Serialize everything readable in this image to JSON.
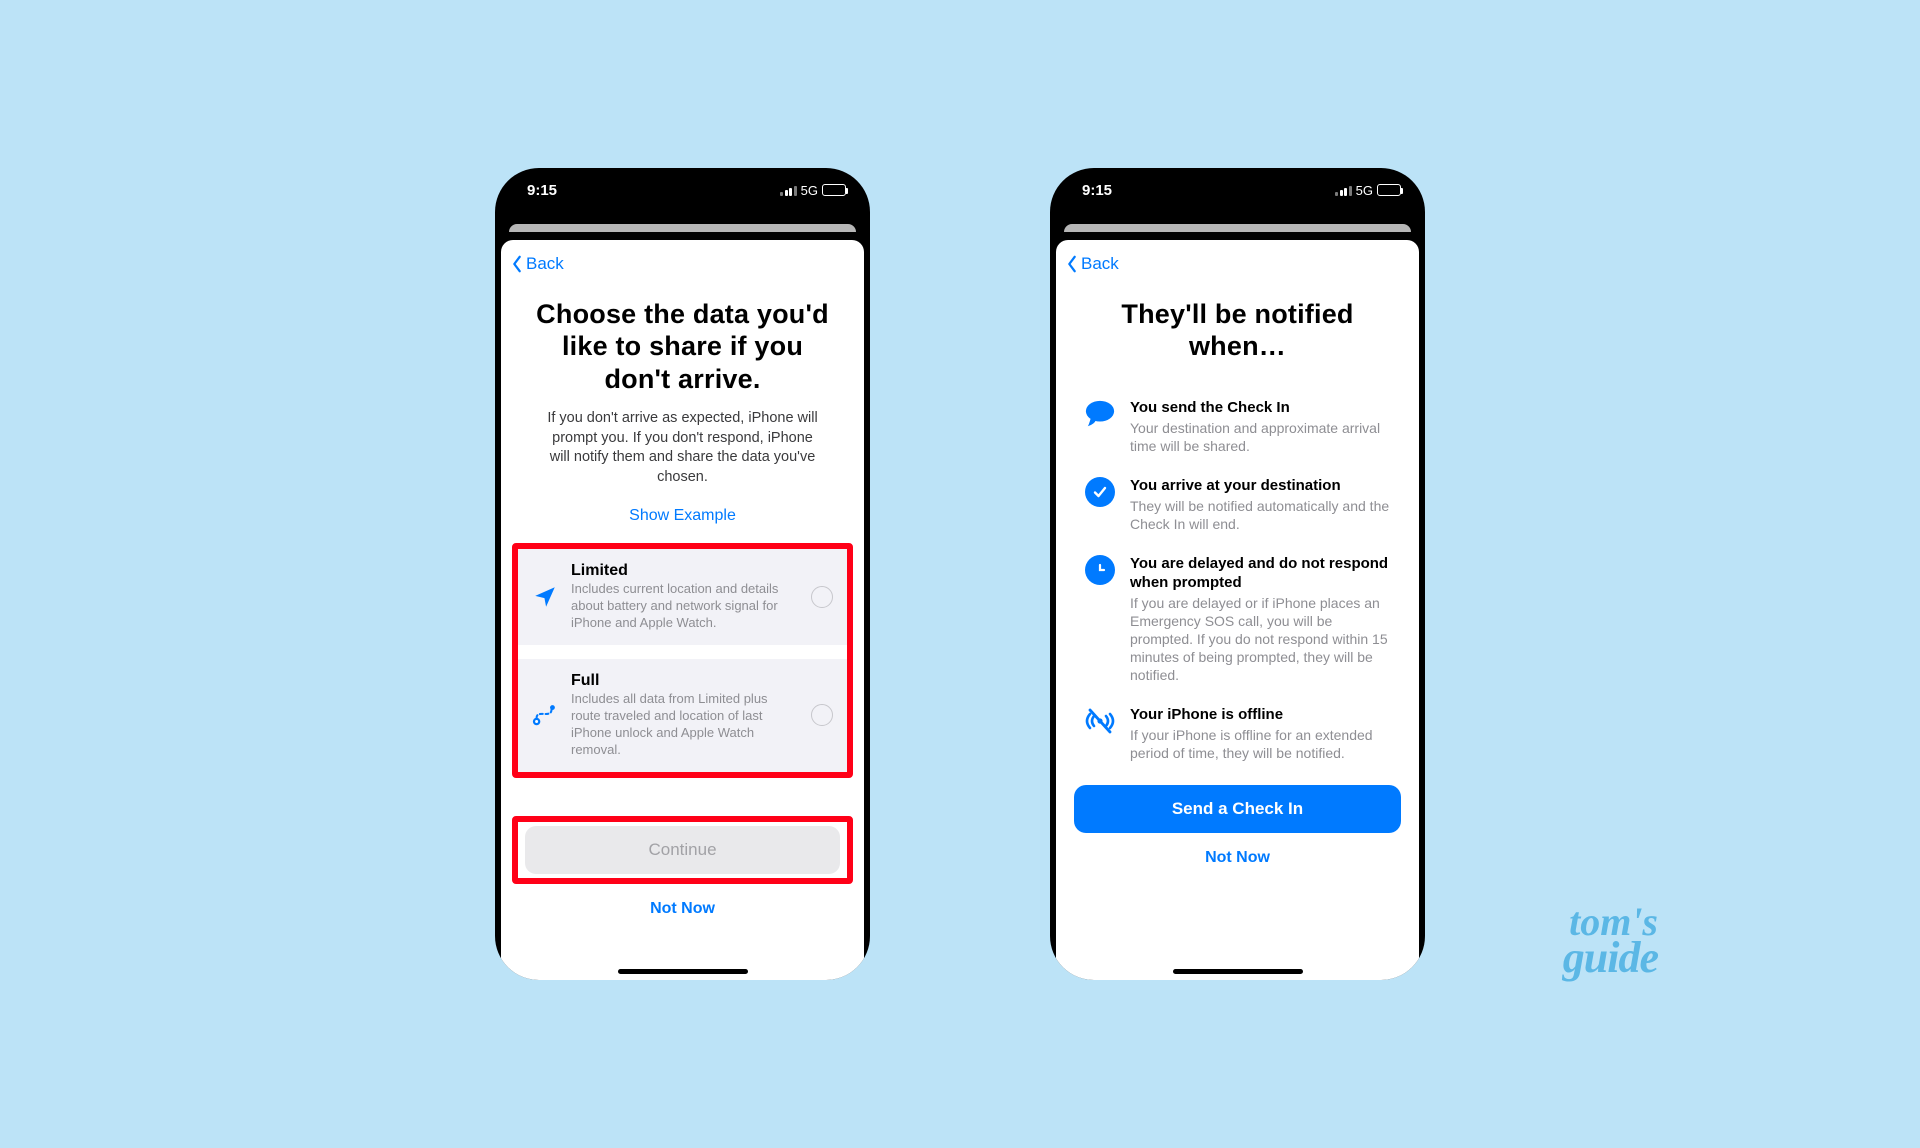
{
  "watermark": {
    "line1": "tom's",
    "line2": "guide"
  },
  "status": {
    "time": "9:15",
    "network": "5G"
  },
  "back_label": "Back",
  "left": {
    "heading": "Choose the data you'd like to share if you don't arrive.",
    "sub": "If you don't arrive as expected, iPhone will prompt you. If you don't respond, iPhone will notify them and share the data you've chosen.",
    "example": "Show Example",
    "options": [
      {
        "title": "Limited",
        "desc": "Includes current location and details about battery and network signal for iPhone and Apple Watch.",
        "icon": "location-arrow"
      },
      {
        "title": "Full",
        "desc": "Includes all data from Limited plus route traveled and location of last iPhone unlock and Apple Watch removal.",
        "icon": "route"
      }
    ],
    "continue": "Continue",
    "not_now": "Not Now"
  },
  "right": {
    "heading": "They'll be notified when…",
    "items": [
      {
        "title": "You send the Check In",
        "desc": "Your destination and approximate arrival time will be shared.",
        "icon": "bubble"
      },
      {
        "title": "You arrive at your destination",
        "desc": "They will be notified automatically and the Check In will end.",
        "icon": "check-circle"
      },
      {
        "title": "You are delayed and do not respond when prompted",
        "desc": "If you are delayed or if iPhone places an Emergency SOS call, you will be prompted. If you do not respond within 15 minutes of being prompted, they will be notified.",
        "icon": "clock"
      },
      {
        "title": "Your iPhone is offline",
        "desc": "If your iPhone is offline for an extended period of time, they will be notified.",
        "icon": "offline"
      }
    ],
    "cta": "Send a Check In",
    "not_now": "Not Now"
  }
}
